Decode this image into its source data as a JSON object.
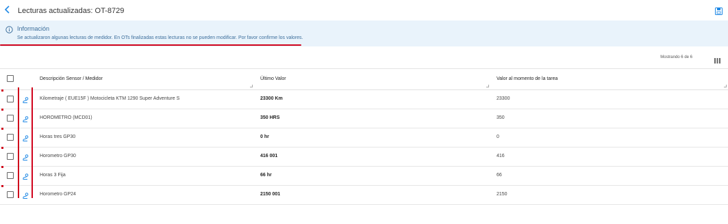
{
  "header": {
    "title": "Lecturas actualizadas: OT-8729",
    "back_icon": "chevron-left-icon",
    "save_icon": "save-icon"
  },
  "info": {
    "title": "Información",
    "text": "Se actualizaron algunas lecturas de medidor. En OTs finalizadas estas lecturas no se pueden modificar. Por favor confirme los valores.",
    "icon": "info-icon"
  },
  "toolbar": {
    "count_label": "Mostrando 6 de 6",
    "columns_icon": "columns-icon"
  },
  "table": {
    "columns": [
      "Descripción Sensor / Medidor",
      "Último Valor",
      "Valor al momento de la tarea"
    ],
    "rows": [
      {
        "description": "Kilometraje ( EUE15F ) Motocicleta KTM 1290 Super Adventure S",
        "last_value": "23300 Km",
        "task_value": "23300"
      },
      {
        "description": "HOROMETRO (MCD01)",
        "last_value": "350 HRS",
        "task_value": "350"
      },
      {
        "description": "Horas tres GP30",
        "last_value": "0 hr",
        "task_value": "0"
      },
      {
        "description": "Horometro GP30",
        "last_value": "416 001",
        "task_value": "416"
      },
      {
        "description": "Horas 3 Fija",
        "last_value": "66 hr",
        "task_value": "66"
      },
      {
        "description": "Horometro GP24",
        "last_value": "2150 001",
        "task_value": "2150"
      }
    ]
  },
  "colors": {
    "accent": "#1e88e5",
    "info_bg": "#e9f3fb",
    "annotation_red": "#d0021b"
  }
}
